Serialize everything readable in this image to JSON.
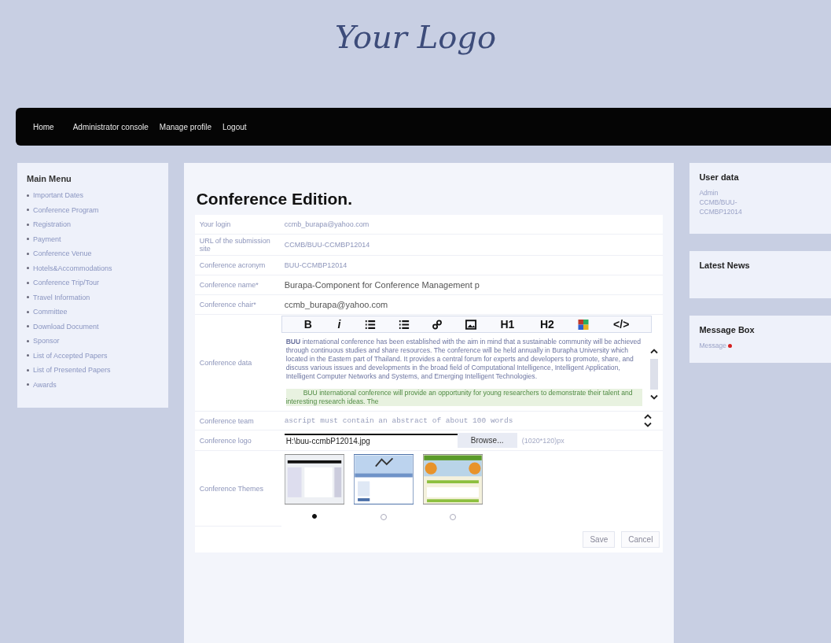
{
  "logo": "Your Logo",
  "nav": [
    {
      "label": "Home"
    },
    {
      "label": "Administrator console"
    },
    {
      "label": "Manage profile"
    },
    {
      "label": "Logout"
    }
  ],
  "main_menu": {
    "title": "Main Menu",
    "items": [
      "Important Dates",
      "Conference Program",
      "Registration",
      "Payment",
      "Conference Venue",
      "Hotels&Accommodations",
      "Conference Trip/Tour",
      "Travel Information",
      "Committee",
      "Download Document",
      "Sponsor",
      "List of Accepted Papers",
      "List of Presented Papers",
      "Awards"
    ]
  },
  "form": {
    "title": "Conference Edition.",
    "rows": [
      {
        "kind": "text",
        "label": "Your login",
        "value": "ccmb_burapa@yahoo.com"
      },
      {
        "kind": "text",
        "label": "URL of the submission site",
        "value": "CCMB/BUU-CCMBP12014"
      },
      {
        "kind": "text",
        "label": "Conference acronym",
        "value": "BUU-CCMBP12014"
      },
      {
        "kind": "input",
        "label": "Conference name*",
        "value": "Burapa-Component for Conference Management p"
      },
      {
        "kind": "input",
        "label": "Conference chair*",
        "value": "ccmb_burapa@yahoo.com"
      }
    ],
    "editor": {
      "label": "Conference data",
      "toolbar": [
        {
          "kind": "text",
          "text": "B"
        },
        {
          "kind": "italic",
          "text": "i"
        },
        {
          "kind": "list"
        },
        {
          "kind": "list"
        },
        {
          "kind": "link"
        },
        {
          "kind": "image"
        },
        {
          "kind": "text",
          "text": "H1"
        },
        {
          "kind": "text",
          "text": "H2"
        },
        {
          "kind": "color"
        },
        {
          "kind": "text",
          "text": "</>"
        }
      ],
      "paragraphs": [
        {
          "highlight": false,
          "text": "**BUU** international conference has been established with the aim in mind that a sustainable community will be achieved through continuous studies and share resources. The conference will be held annually in Burapha University which located in the Eastern part of Thailand. It provides a central forum for experts and developers to promote, share, and discuss various issues and developments in the broad field of Computational Intelligence, Intelligent Application, Intelligent Computer Networks and Systems, and Emerging Intelligent Technologies."
        },
        {
          "highlight": true,
          "text": "BUU international conference will provide an opportunity for young researchers to demonstrate their talent and interesting research ideas. The"
        }
      ]
    },
    "team": {
      "label": "Conference team",
      "value": "ascript must contain an abstract of about 100 words"
    },
    "logo_file": {
      "label": "Conference logo",
      "value": "H:\\buu-ccmbP12014.jpg",
      "button": "Browse...",
      "hint": "(1020*120)px"
    },
    "themes": {
      "label": "Conference Themes",
      "items": [
        {
          "selected": true
        },
        {
          "selected": false
        },
        {
          "selected": false
        }
      ]
    },
    "buttons": [
      "Save",
      "Cancel"
    ]
  },
  "user_data": {
    "title": "User data",
    "lines": [
      "Admin",
      "CCMB/BUU-CCMBP12014"
    ]
  },
  "latest_news": {
    "title": "Latest News"
  },
  "message_box": {
    "title": "Message Box",
    "link": "Message"
  }
}
